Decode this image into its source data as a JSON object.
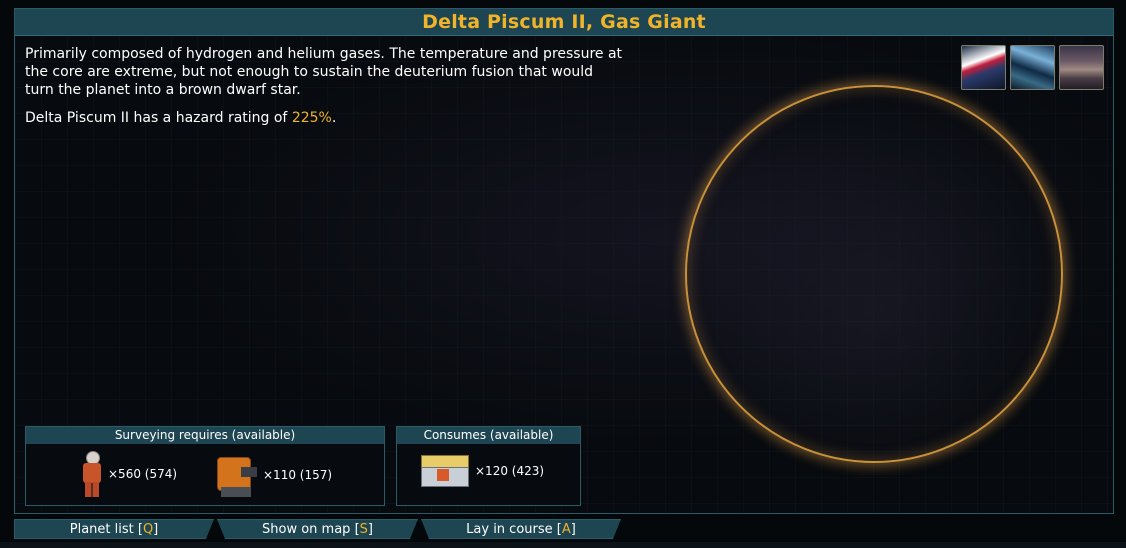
{
  "title": "Delta Piscum II, Gas Giant",
  "description": "Primarily composed of hydrogen and helium gases. The temperature and pressure at the core are extreme, but not enough to sustain the deuterium fusion that would turn the planet into a brown dwarf star.",
  "hazard": {
    "prefix": "Delta Piscum II has a hazard rating of ",
    "value": "225%",
    "suffix": "."
  },
  "colors": {
    "accent": "#f0b32a",
    "header_bg": "#1d4552",
    "border": "#2c5a66",
    "planet_ring": "#c8913a"
  },
  "thumbnails": [
    {
      "icon": "surface-thumbnail-1"
    },
    {
      "icon": "surface-thumbnail-2"
    },
    {
      "icon": "surface-thumbnail-3"
    }
  ],
  "surveying": {
    "header": "Surveying requires (available)",
    "items": [
      {
        "icon": "crew-icon",
        "amount": "×560 (574)"
      },
      {
        "icon": "drilling-rig-icon",
        "amount": "×110 (157)"
      }
    ]
  },
  "consumes": {
    "header": "Consumes (available)",
    "items": [
      {
        "icon": "supply-crate-icon",
        "amount": "×120 (423)"
      }
    ]
  },
  "nav": {
    "planet_list": {
      "label": "Planet list [",
      "key": "Q",
      "end": "]"
    },
    "show_on_map": {
      "label": "Show on map [",
      "key": "S",
      "end": "]"
    },
    "lay_in_course": {
      "label": "Lay in course [",
      "key": "A",
      "end": "]"
    }
  }
}
